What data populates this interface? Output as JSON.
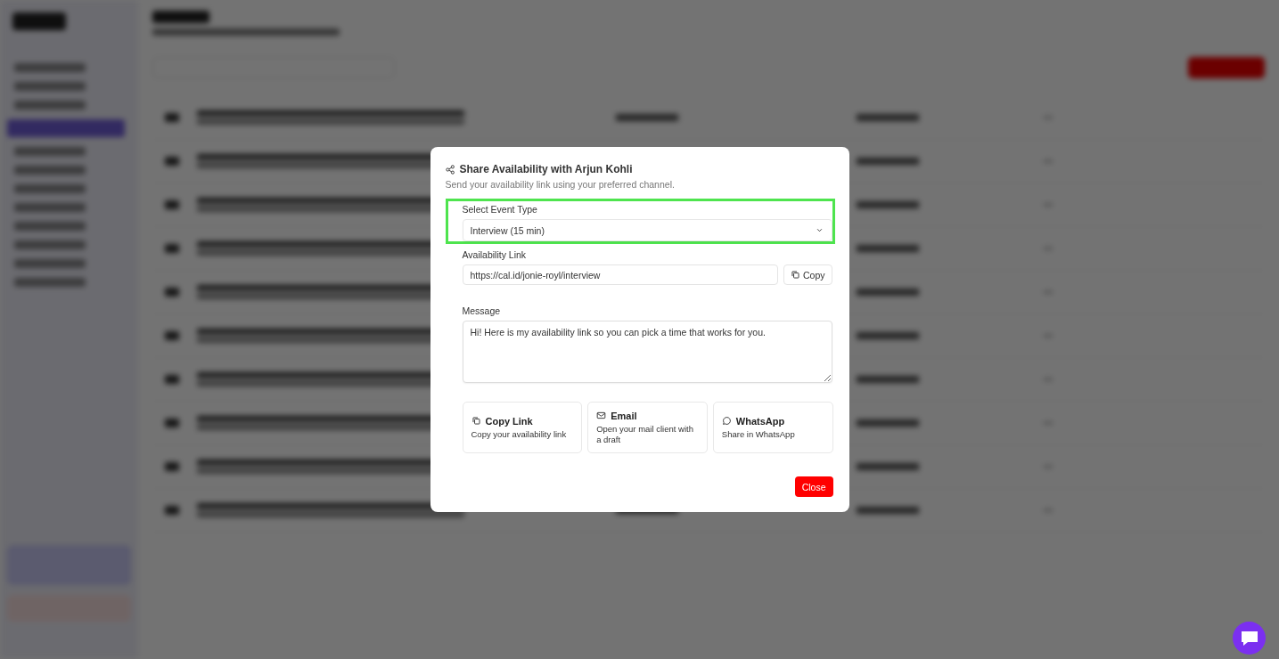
{
  "dialog": {
    "title": "Share Availability with Arjun Kohli",
    "subtitle": "Send your availability link using your preferred channel.",
    "event_type": {
      "label": "Select Event Type",
      "value": "Interview (15 min)",
      "highlighted": true
    },
    "availability_link": {
      "label": "Availability Link",
      "value": "https://cal.id/jonie-royl/interview",
      "copy_button": "Copy"
    },
    "message": {
      "label": "Message",
      "value": "Hi! Here is my availability link so you can pick a time that works for you."
    },
    "channels": [
      {
        "kind": "copy",
        "title": "Copy Link",
        "description": "Copy your availability link"
      },
      {
        "kind": "email",
        "title": "Email",
        "description": "Open your mail client with a draft"
      },
      {
        "kind": "whatsapp",
        "title": "WhatsApp",
        "description": "Share in WhatsApp"
      }
    ],
    "close_button": "Close"
  }
}
